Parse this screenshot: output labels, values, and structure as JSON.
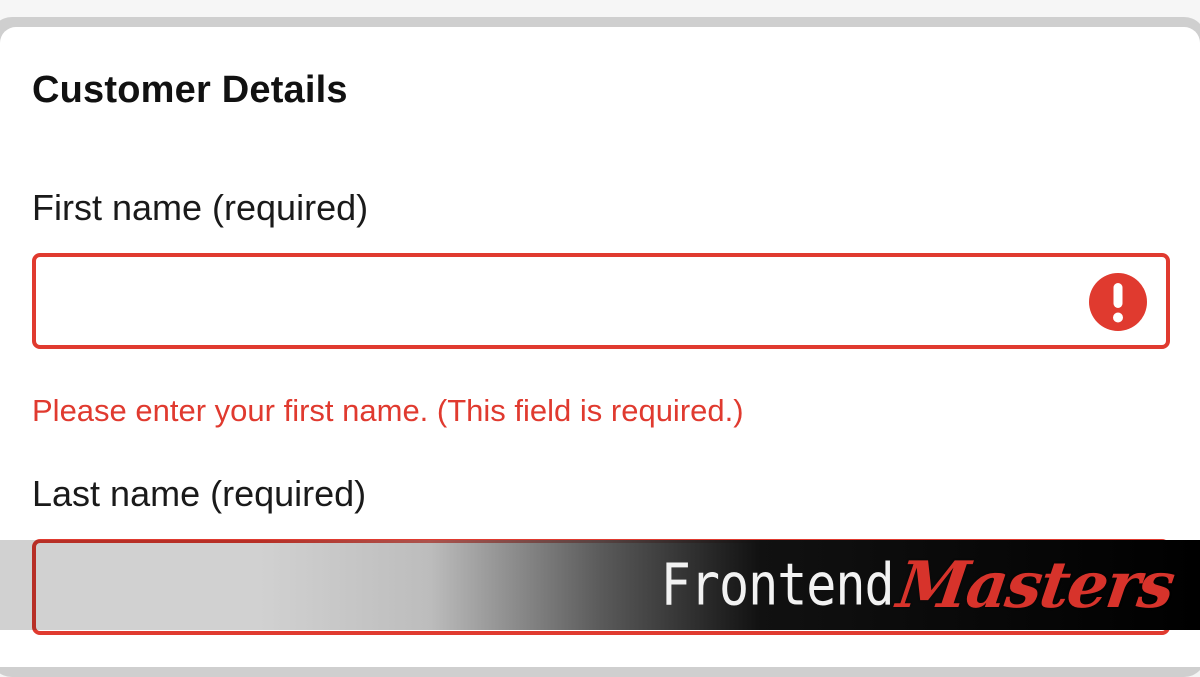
{
  "form": {
    "heading": "Customer Details",
    "fields": [
      {
        "label": "First name (required)",
        "value": "",
        "error": "Please enter your first name. (This field is required.)",
        "state": "invalid"
      },
      {
        "label": "Last name (required)",
        "value": "",
        "state": "invalid"
      }
    ],
    "icons": {
      "error": "exclamation-circle-icon"
    }
  },
  "branding": {
    "part1": "Frontend",
    "part2": "Masters"
  },
  "colors": {
    "error": "#e03a2f",
    "brand_accent": "#d7332b",
    "text": "#111111",
    "card": "#ffffff"
  }
}
